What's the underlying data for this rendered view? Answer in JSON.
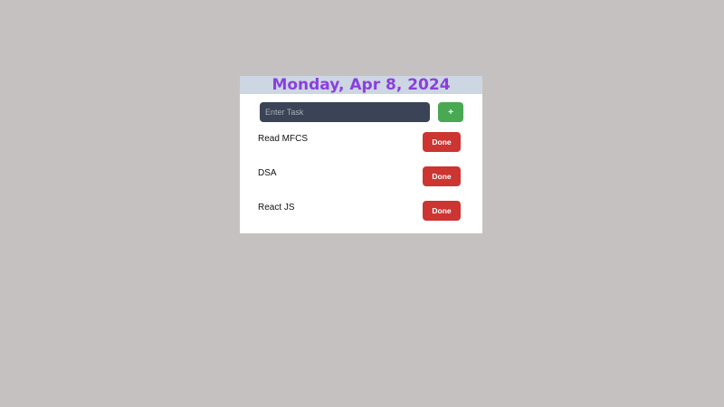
{
  "header": {
    "date": "Monday, Apr 8, 2024"
  },
  "input": {
    "placeholder": "Enter Task",
    "value": ""
  },
  "add_button": {
    "label": "+"
  },
  "tasks": [
    {
      "label": "Read MFCS",
      "button": "Done"
    },
    {
      "label": "DSA",
      "button": "Done"
    },
    {
      "label": "React JS",
      "button": "Done"
    }
  ],
  "colors": {
    "background": "#c6c1c1",
    "header_bg": "#cdd6e3",
    "date_text": "#8a3fdf",
    "input_bg": "#3b4356",
    "add_button": "#49a852",
    "done_button": "#cc3531"
  }
}
